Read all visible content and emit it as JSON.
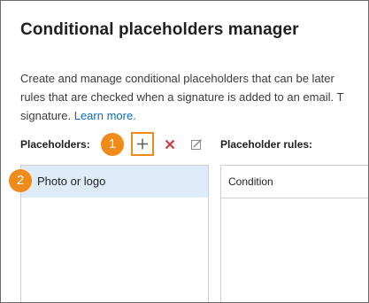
{
  "dialog": {
    "title": "Conditional placeholders manager",
    "description_lines": [
      "Create and manage conditional placeholders that can be later",
      "rules that are checked when a signature is added to an email. T",
      "signature."
    ],
    "learn_more": "Learn more."
  },
  "placeholders": {
    "label": "Placeholders:",
    "items": [
      {
        "label": "Photo or logo",
        "selected": true
      }
    ]
  },
  "toolbar": {
    "add_icon": "plus-icon",
    "delete_icon": "x-icon",
    "edit_icon": "edit-icon"
  },
  "rules": {
    "label": "Placeholder rules:",
    "columns": [
      "Condition"
    ]
  },
  "callouts": [
    "1",
    "2"
  ],
  "colors": {
    "accent_orange": "#f08a19",
    "selection": "#deecf9",
    "link": "#0f6cbd",
    "delete_red": "#d13438"
  }
}
